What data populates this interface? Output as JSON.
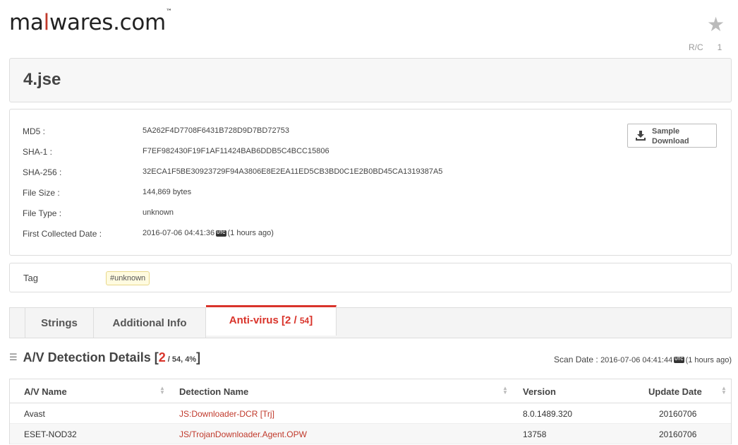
{
  "brand": {
    "logo_pre": "ma",
    "logo_fork": "l",
    "logo_post": "wares.com",
    "logo_tm": "™"
  },
  "header": {
    "rc_label": "R/C",
    "rc_count": "1"
  },
  "file": {
    "name": "4.jse"
  },
  "details": [
    {
      "label": "MD5 :",
      "value": "5A262F4D7708F6431B728D9D7BD72753"
    },
    {
      "label": "SHA-1 :",
      "value": "F7EF982430F19F1AF11424BAB6DDB5C4BCC15806"
    },
    {
      "label": "SHA-256 :",
      "value": "32ECA1F5BE30923729F94A3806E8E2EA11ED5CB3BD0C1E2B0BD45CA1319387A5"
    },
    {
      "label": "File Size :",
      "value": "144,869 bytes"
    },
    {
      "label": "File Type :",
      "value": "unknown"
    },
    {
      "label": "First Collected Date :",
      "value": "2016-07-06 04:41:36",
      "utc": "UTC",
      "ago": "(1 hours ago)"
    }
  ],
  "download": {
    "label_line1": "Sample",
    "label_line2": "Download"
  },
  "tag": {
    "label": "Tag",
    "value": "#unknown"
  },
  "tabs": [
    {
      "label": "Strings"
    },
    {
      "label": "Additional Info"
    },
    {
      "label_pre": "Anti-virus [",
      "detected": "2",
      "sep": " / ",
      "total": "54",
      "close": "]"
    }
  ],
  "av_section": {
    "title": "A/V Detection Details [",
    "detected": "2",
    "rest": " / 54, 4%",
    "close": "]",
    "scan_label": "Scan Date :",
    "scan_date": "2016-07-06 04:41:44",
    "utc": "UTC",
    "scan_ago": "(1 hours ago)"
  },
  "table": {
    "columns": [
      "A/V Name",
      "Detection Name",
      "Version",
      "Update Date"
    ],
    "rows": [
      {
        "av": "Avast",
        "detection": "JS:Downloader-DCR [Trj]",
        "version": "8.0.1489.320",
        "date": "20160706"
      },
      {
        "av": "ESET-NOD32",
        "detection": "JS/TrojanDownloader.Agent.OPW",
        "version": "13758",
        "date": "20160706"
      }
    ]
  },
  "colors": {
    "accent": "#d9342b",
    "border": "#dddddd"
  }
}
